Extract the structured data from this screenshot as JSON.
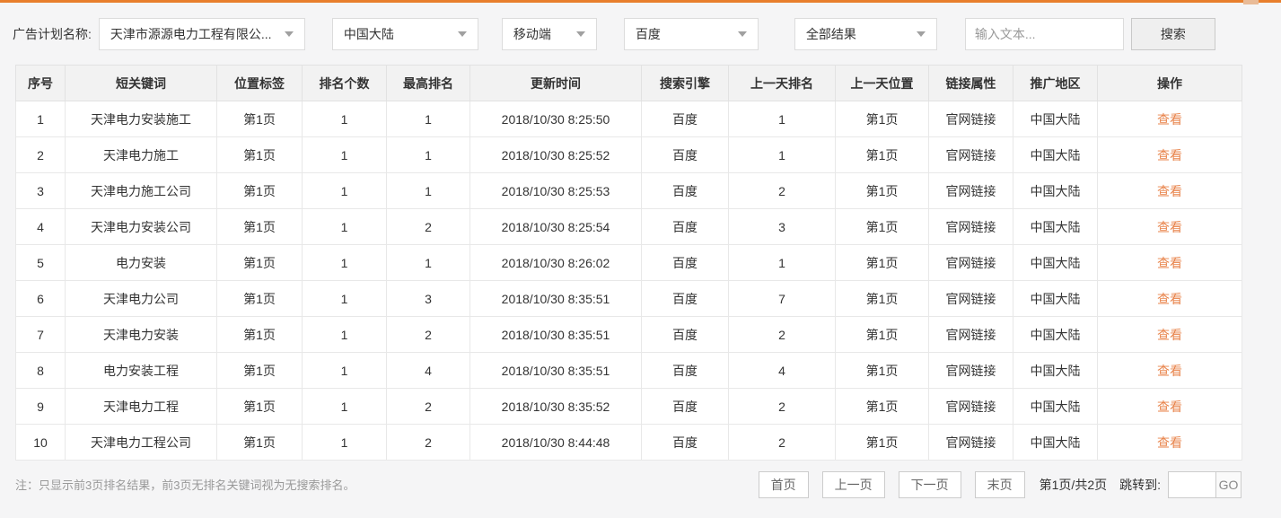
{
  "filter_bar": {
    "label": "广告计划名称:",
    "dropdowns": [
      {
        "name": "plan",
        "value": "天津市源源电力工程有限公..."
      },
      {
        "name": "region",
        "value": "中国大陆"
      },
      {
        "name": "device",
        "value": "移动端"
      },
      {
        "name": "engine",
        "value": "百度"
      },
      {
        "name": "result",
        "value": "全部结果"
      }
    ],
    "search_input_placeholder": "输入文本...",
    "search_button": "搜索"
  },
  "table": {
    "headers": [
      "序号",
      "短关键词",
      "位置标签",
      "排名个数",
      "最高排名",
      "更新时间",
      "搜索引擎",
      "上一天排名",
      "上一天位置",
      "链接属性",
      "推广地区",
      "操作"
    ],
    "action_label": "查看",
    "rows": [
      [
        "1",
        "天津电力安装施工",
        "第1页",
        "1",
        "1",
        "2018/10/30 8:25:50",
        "百度",
        "1",
        "第1页",
        "官网链接",
        "中国大陆"
      ],
      [
        "2",
        "天津电力施工",
        "第1页",
        "1",
        "1",
        "2018/10/30 8:25:52",
        "百度",
        "1",
        "第1页",
        "官网链接",
        "中国大陆"
      ],
      [
        "3",
        "天津电力施工公司",
        "第1页",
        "1",
        "1",
        "2018/10/30 8:25:53",
        "百度",
        "2",
        "第1页",
        "官网链接",
        "中国大陆"
      ],
      [
        "4",
        "天津电力安装公司",
        "第1页",
        "1",
        "2",
        "2018/10/30 8:25:54",
        "百度",
        "3",
        "第1页",
        "官网链接",
        "中国大陆"
      ],
      [
        "5",
        "电力安装",
        "第1页",
        "1",
        "1",
        "2018/10/30 8:26:02",
        "百度",
        "1",
        "第1页",
        "官网链接",
        "中国大陆"
      ],
      [
        "6",
        "天津电力公司",
        "第1页",
        "1",
        "3",
        "2018/10/30 8:35:51",
        "百度",
        "7",
        "第1页",
        "官网链接",
        "中国大陆"
      ],
      [
        "7",
        "天津电力安装",
        "第1页",
        "1",
        "2",
        "2018/10/30 8:35:51",
        "百度",
        "2",
        "第1页",
        "官网链接",
        "中国大陆"
      ],
      [
        "8",
        "电力安装工程",
        "第1页",
        "1",
        "4",
        "2018/10/30 8:35:51",
        "百度",
        "4",
        "第1页",
        "官网链接",
        "中国大陆"
      ],
      [
        "9",
        "天津电力工程",
        "第1页",
        "1",
        "2",
        "2018/10/30 8:35:52",
        "百度",
        "2",
        "第1页",
        "官网链接",
        "中国大陆"
      ],
      [
        "10",
        "天津电力工程公司",
        "第1页",
        "1",
        "2",
        "2018/10/30 8:44:48",
        "百度",
        "2",
        "第1页",
        "官网链接",
        "中国大陆"
      ]
    ]
  },
  "footer": {
    "note": "注：只显示前3页排名结果，前3页无排名关键词视为无搜索排名。",
    "pagination": {
      "first": "首页",
      "prev": "上一页",
      "next": "下一页",
      "last": "末页",
      "page_info": "第1页/共2页",
      "jump_label": "跳转到:",
      "go": "GO"
    }
  },
  "colors": {
    "accent_orange": "#e87e2c",
    "link_orange": "#e8834a",
    "header_bg": "#f2f2f2",
    "page_bg": "#f5f5f6"
  }
}
